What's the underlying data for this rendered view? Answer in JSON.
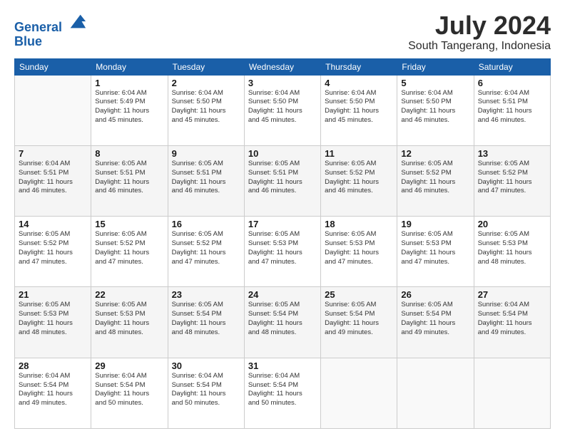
{
  "header": {
    "logo_line1": "General",
    "logo_line2": "Blue",
    "month_year": "July 2024",
    "location": "South Tangerang, Indonesia"
  },
  "days_of_week": [
    "Sunday",
    "Monday",
    "Tuesday",
    "Wednesday",
    "Thursday",
    "Friday",
    "Saturday"
  ],
  "weeks": [
    [
      {
        "day": "",
        "info": ""
      },
      {
        "day": "1",
        "info": "Sunrise: 6:04 AM\nSunset: 5:49 PM\nDaylight: 11 hours\nand 45 minutes."
      },
      {
        "day": "2",
        "info": "Sunrise: 6:04 AM\nSunset: 5:50 PM\nDaylight: 11 hours\nand 45 minutes."
      },
      {
        "day": "3",
        "info": "Sunrise: 6:04 AM\nSunset: 5:50 PM\nDaylight: 11 hours\nand 45 minutes."
      },
      {
        "day": "4",
        "info": "Sunrise: 6:04 AM\nSunset: 5:50 PM\nDaylight: 11 hours\nand 45 minutes."
      },
      {
        "day": "5",
        "info": "Sunrise: 6:04 AM\nSunset: 5:50 PM\nDaylight: 11 hours\nand 46 minutes."
      },
      {
        "day": "6",
        "info": "Sunrise: 6:04 AM\nSunset: 5:51 PM\nDaylight: 11 hours\nand 46 minutes."
      }
    ],
    [
      {
        "day": "7",
        "info": "Sunrise: 6:04 AM\nSunset: 5:51 PM\nDaylight: 11 hours\nand 46 minutes."
      },
      {
        "day": "8",
        "info": "Sunrise: 6:05 AM\nSunset: 5:51 PM\nDaylight: 11 hours\nand 46 minutes."
      },
      {
        "day": "9",
        "info": "Sunrise: 6:05 AM\nSunset: 5:51 PM\nDaylight: 11 hours\nand 46 minutes."
      },
      {
        "day": "10",
        "info": "Sunrise: 6:05 AM\nSunset: 5:51 PM\nDaylight: 11 hours\nand 46 minutes."
      },
      {
        "day": "11",
        "info": "Sunrise: 6:05 AM\nSunset: 5:52 PM\nDaylight: 11 hours\nand 46 minutes."
      },
      {
        "day": "12",
        "info": "Sunrise: 6:05 AM\nSunset: 5:52 PM\nDaylight: 11 hours\nand 46 minutes."
      },
      {
        "day": "13",
        "info": "Sunrise: 6:05 AM\nSunset: 5:52 PM\nDaylight: 11 hours\nand 47 minutes."
      }
    ],
    [
      {
        "day": "14",
        "info": "Sunrise: 6:05 AM\nSunset: 5:52 PM\nDaylight: 11 hours\nand 47 minutes."
      },
      {
        "day": "15",
        "info": "Sunrise: 6:05 AM\nSunset: 5:52 PM\nDaylight: 11 hours\nand 47 minutes."
      },
      {
        "day": "16",
        "info": "Sunrise: 6:05 AM\nSunset: 5:52 PM\nDaylight: 11 hours\nand 47 minutes."
      },
      {
        "day": "17",
        "info": "Sunrise: 6:05 AM\nSunset: 5:53 PM\nDaylight: 11 hours\nand 47 minutes."
      },
      {
        "day": "18",
        "info": "Sunrise: 6:05 AM\nSunset: 5:53 PM\nDaylight: 11 hours\nand 47 minutes."
      },
      {
        "day": "19",
        "info": "Sunrise: 6:05 AM\nSunset: 5:53 PM\nDaylight: 11 hours\nand 47 minutes."
      },
      {
        "day": "20",
        "info": "Sunrise: 6:05 AM\nSunset: 5:53 PM\nDaylight: 11 hours\nand 48 minutes."
      }
    ],
    [
      {
        "day": "21",
        "info": "Sunrise: 6:05 AM\nSunset: 5:53 PM\nDaylight: 11 hours\nand 48 minutes."
      },
      {
        "day": "22",
        "info": "Sunrise: 6:05 AM\nSunset: 5:53 PM\nDaylight: 11 hours\nand 48 minutes."
      },
      {
        "day": "23",
        "info": "Sunrise: 6:05 AM\nSunset: 5:54 PM\nDaylight: 11 hours\nand 48 minutes."
      },
      {
        "day": "24",
        "info": "Sunrise: 6:05 AM\nSunset: 5:54 PM\nDaylight: 11 hours\nand 48 minutes."
      },
      {
        "day": "25",
        "info": "Sunrise: 6:05 AM\nSunset: 5:54 PM\nDaylight: 11 hours\nand 49 minutes."
      },
      {
        "day": "26",
        "info": "Sunrise: 6:05 AM\nSunset: 5:54 PM\nDaylight: 11 hours\nand 49 minutes."
      },
      {
        "day": "27",
        "info": "Sunrise: 6:04 AM\nSunset: 5:54 PM\nDaylight: 11 hours\nand 49 minutes."
      }
    ],
    [
      {
        "day": "28",
        "info": "Sunrise: 6:04 AM\nSunset: 5:54 PM\nDaylight: 11 hours\nand 49 minutes."
      },
      {
        "day": "29",
        "info": "Sunrise: 6:04 AM\nSunset: 5:54 PM\nDaylight: 11 hours\nand 50 minutes."
      },
      {
        "day": "30",
        "info": "Sunrise: 6:04 AM\nSunset: 5:54 PM\nDaylight: 11 hours\nand 50 minutes."
      },
      {
        "day": "31",
        "info": "Sunrise: 6:04 AM\nSunset: 5:54 PM\nDaylight: 11 hours\nand 50 minutes."
      },
      {
        "day": "",
        "info": ""
      },
      {
        "day": "",
        "info": ""
      },
      {
        "day": "",
        "info": ""
      }
    ]
  ]
}
